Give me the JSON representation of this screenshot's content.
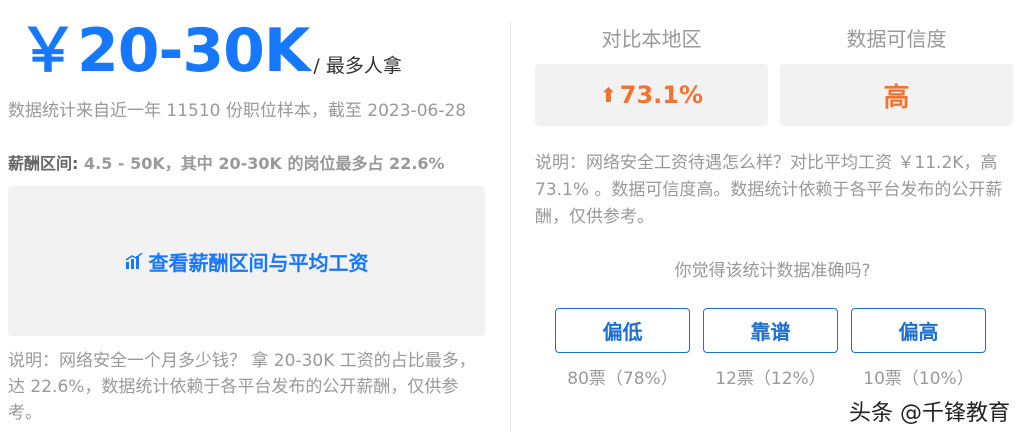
{
  "salary": {
    "main": "￥20-30K",
    "suffix": "/ 最多人拿",
    "sample_text": "数据统计来自近一年 11510 份职位样本，截至 2023-06-28",
    "range_title": "薪酬区间: ",
    "range_text": "4.5 - 50K，其中 20-30K 的岗位最多占 22.6%",
    "chart_link_label": "查看薪酬区间与平均工资",
    "note": "说明：网络安全一个月多少钱？ 拿 20-30K 工资的占比最多，达 22.6%，数据统计依赖于各平台发布的公开薪酬，仅供参考。"
  },
  "stats": {
    "compare_label": "对比本地区",
    "compare_value": "73.1%",
    "trust_label": "数据可信度",
    "trust_value": "高",
    "note": "说明：网络安全工资待遇怎么样？对比平均工资 ￥11.2K，高 73.1% 。数据可信度高。数据统计依赖于各平台发布的公开薪酬，仅供参考。"
  },
  "vote": {
    "question": "你觉得该统计数据准确吗?",
    "options": [
      {
        "label": "偏低",
        "count": "80票（78%）"
      },
      {
        "label": "靠谱",
        "count": "12票（12%）"
      },
      {
        "label": "偏高",
        "count": "10票（10%）"
      }
    ]
  },
  "watermark": "头条 @千锋教育",
  "colors": {
    "accent_blue": "#1677ff",
    "orange": "#f07430",
    "box_gray": "#f2f2f2"
  },
  "icons": {
    "chart": "bar-chart-icon",
    "up": "arrow-up-icon"
  }
}
